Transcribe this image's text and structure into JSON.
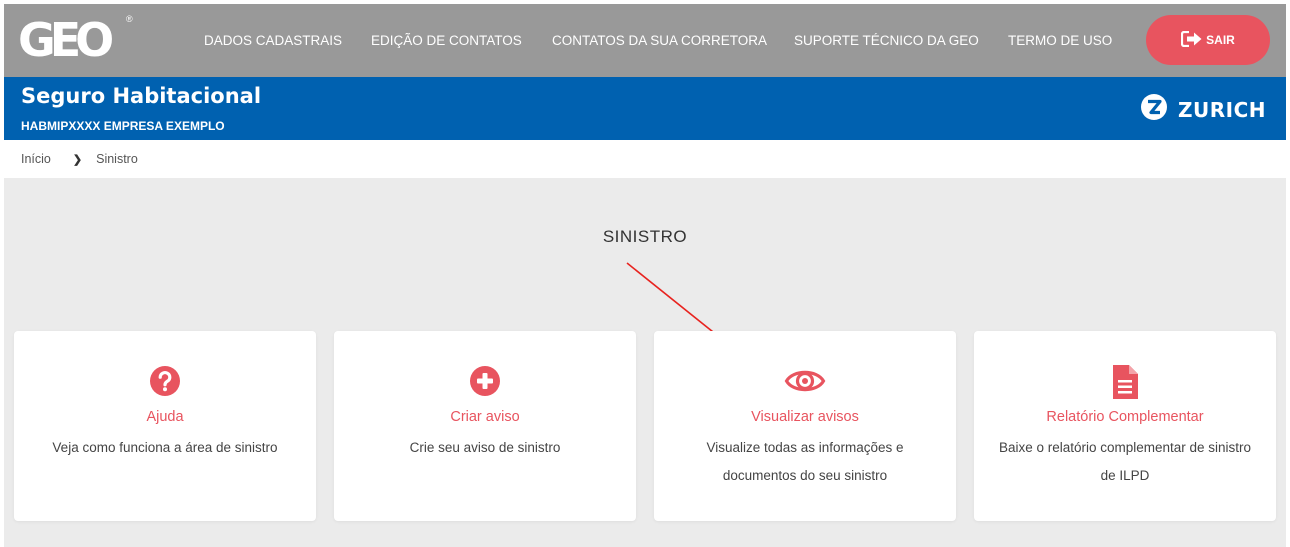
{
  "brand": {
    "logo_text": "GEO",
    "registered": "®"
  },
  "nav": {
    "items": [
      {
        "label": "DADOS CADASTRAIS"
      },
      {
        "label": "EDIÇÃO DE CONTATOS"
      },
      {
        "label": "CONTATOS DA SUA CORRETORA"
      },
      {
        "label": "SUPORTE TÉCNICO DA GEO"
      },
      {
        "label": "TERMO DE USO"
      }
    ],
    "logout_label": "SAIR",
    "logout_icon": "sign-out-icon"
  },
  "product": {
    "title": "Seguro Habitacional",
    "code": "HABMIPXXXX",
    "company": "EMPRESA EXEMPLO",
    "insurer": "ZURICH"
  },
  "breadcrumb": {
    "home": "Início",
    "current": "Sinistro"
  },
  "main": {
    "title": "SINISTRO",
    "cards": [
      {
        "icon": "question-circle-icon",
        "title": "Ajuda",
        "desc": "Veja como funciona a área de sinistro"
      },
      {
        "icon": "plus-circle-icon",
        "title": "Criar aviso",
        "desc": "Crie seu aviso de sinistro"
      },
      {
        "icon": "eye-icon",
        "title": "Visualizar avisos",
        "desc": "Visualize todas as informações e documentos do seu sinistro"
      },
      {
        "icon": "file-text-icon",
        "title": "Relatório Complementar",
        "desc": "Baixe o relatório complementar de sinistro de ILPD"
      }
    ]
  },
  "colors": {
    "topbar": "#999999",
    "product_bar": "#0061b0",
    "accent": "#e8545f",
    "content_bg": "#ebebeb",
    "annotation_arrow": "#e8231f"
  }
}
